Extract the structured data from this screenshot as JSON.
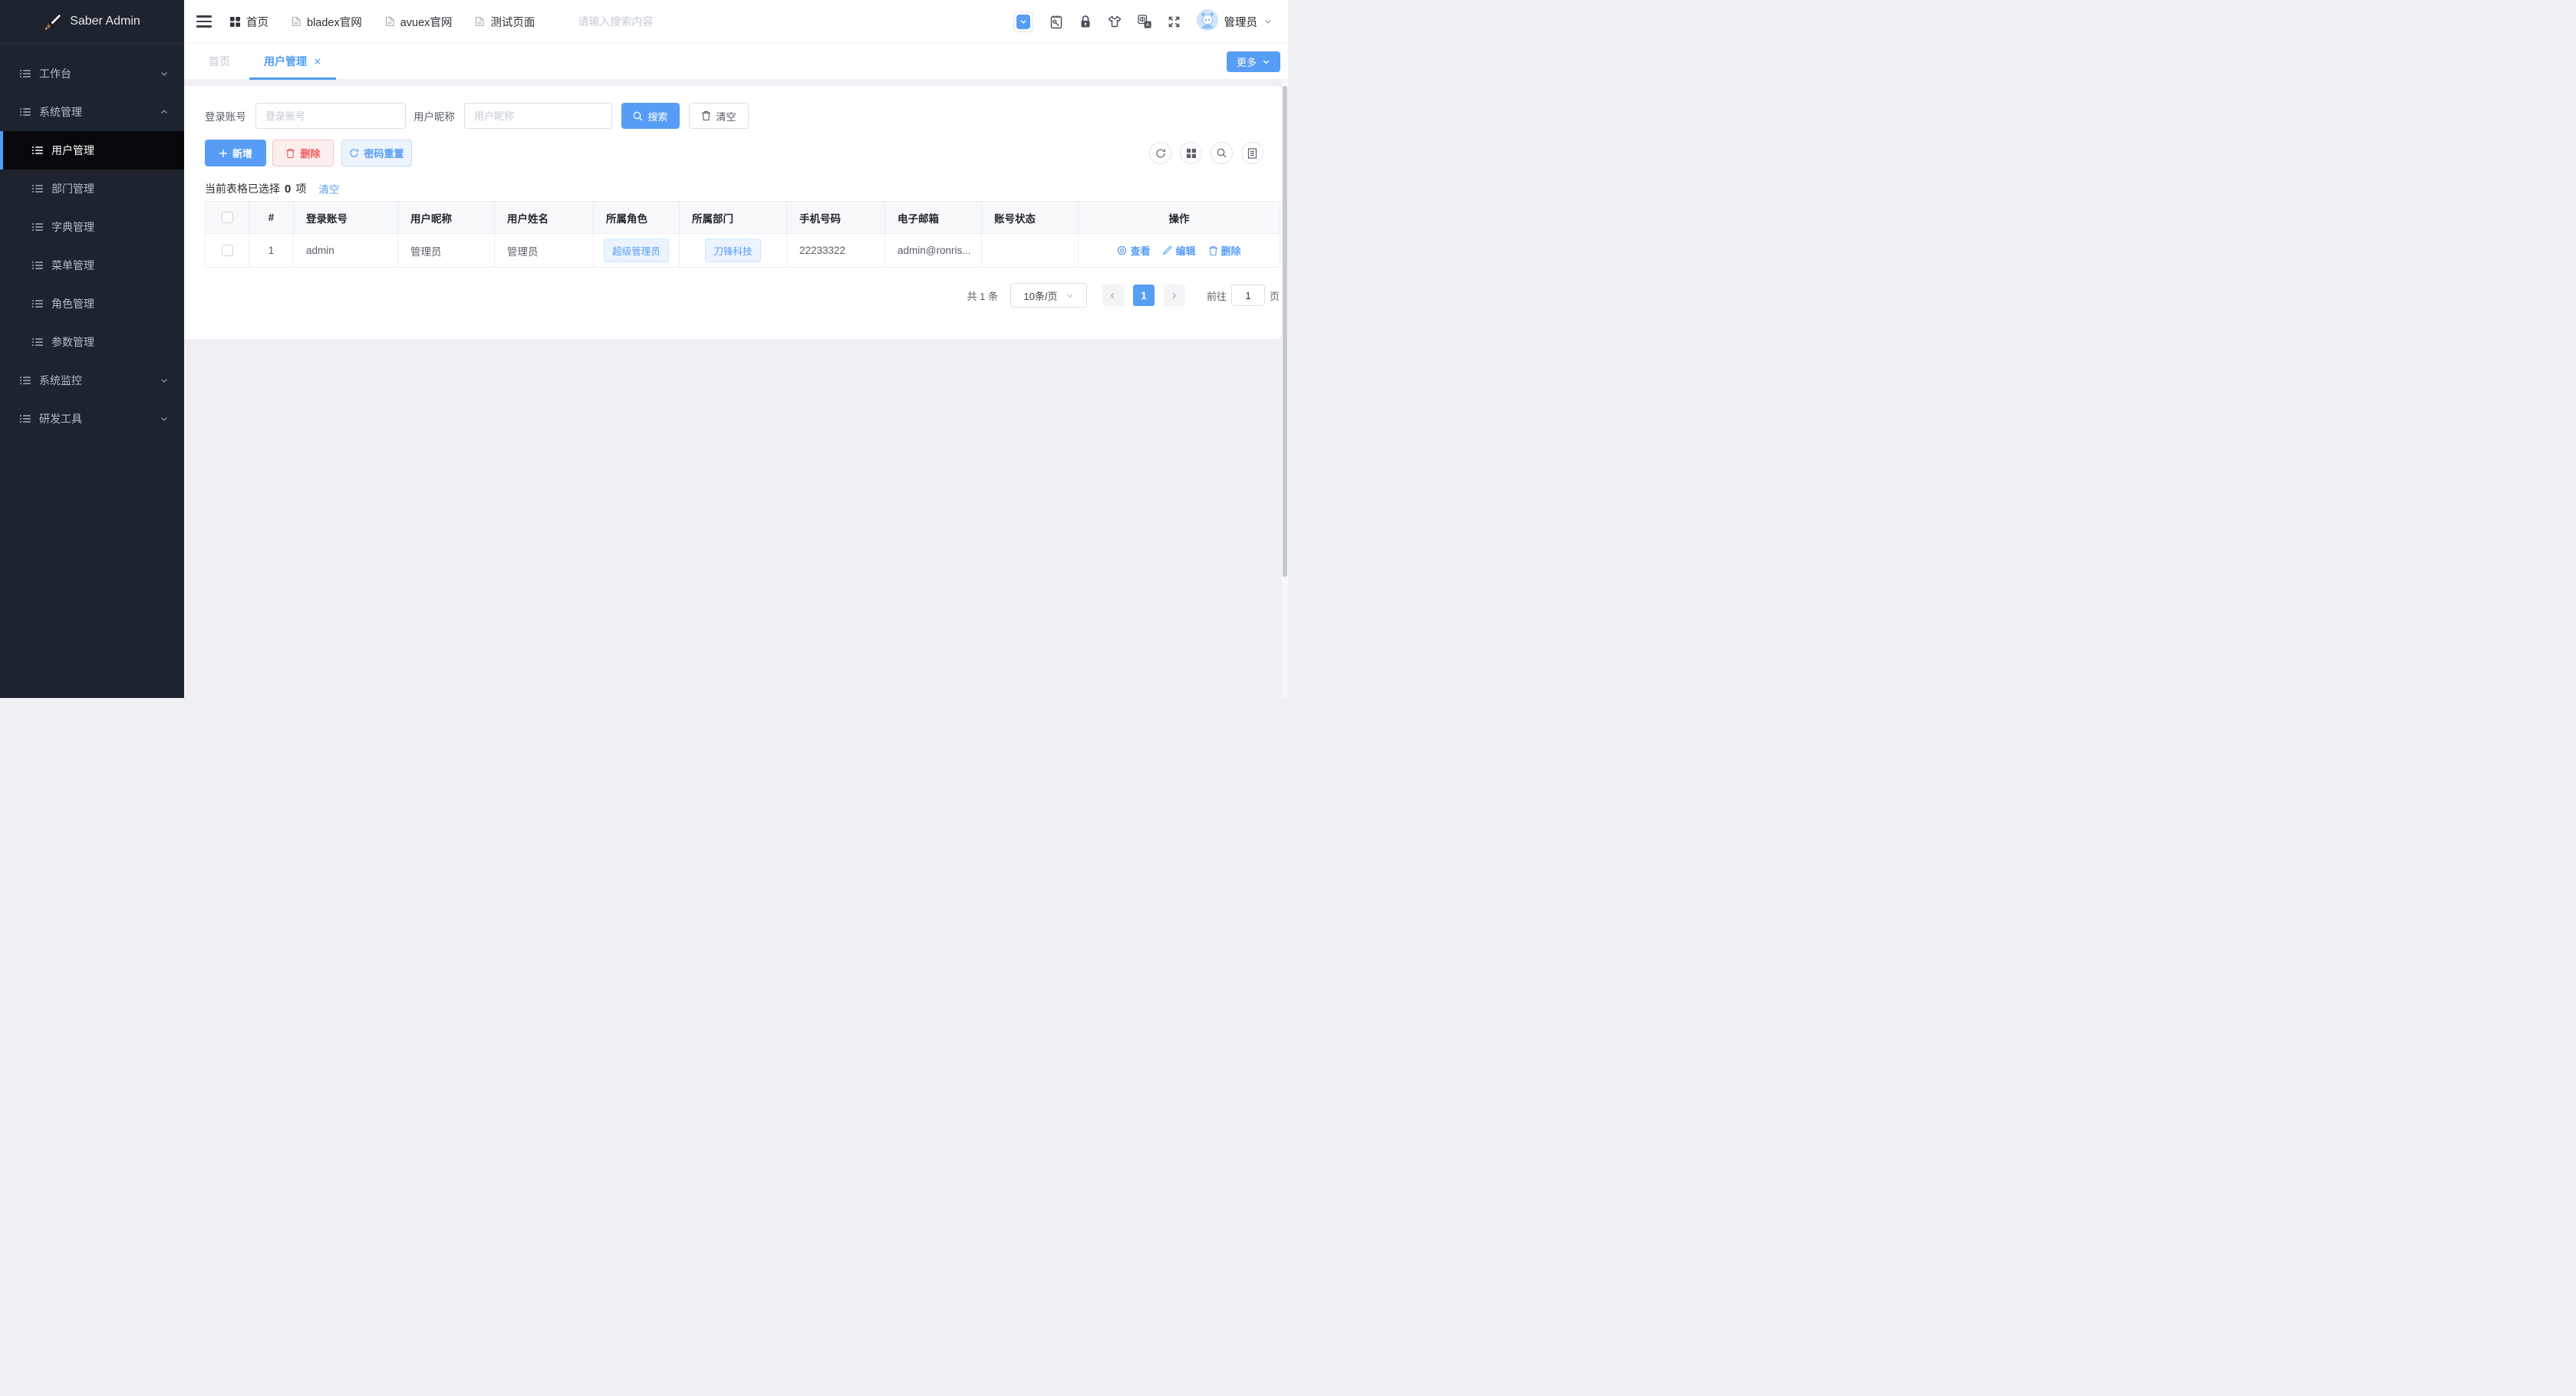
{
  "app": {
    "title": "Saber Admin"
  },
  "colors": {
    "primary": "#579df5",
    "danger": "#f15b5b",
    "sidebar_bg": "#1e242d",
    "sidebar_active_bg": "#07080b",
    "content_bg": "#eef0f4",
    "tag_bg": "#eaf3fe"
  },
  "icons": {
    "logo": "sword-icon",
    "topbar_left": [
      "hamburger-icon",
      "grid-icon",
      "document-icon"
    ],
    "topbar_right": [
      "collapse-toggle-icon",
      "clipboard-wrench-icon",
      "lock-icon",
      "tshirt-icon",
      "translate-icon",
      "fullscreen-icon"
    ],
    "toolbar_circles": [
      "refresh-icon",
      "grid-icon",
      "search-icon",
      "list-icon"
    ],
    "row_actions": [
      "eye-icon",
      "pencil-icon",
      "trash-icon"
    ]
  },
  "sidebar": {
    "items": [
      {
        "label": "工作台"
      },
      {
        "label": "系统管理"
      },
      {
        "label": "系统监控"
      },
      {
        "label": "研发工具"
      }
    ],
    "system_children": [
      {
        "label": "用户管理"
      },
      {
        "label": "部门管理"
      },
      {
        "label": "字典管理"
      },
      {
        "label": "菜单管理"
      },
      {
        "label": "角色管理"
      },
      {
        "label": "参数管理"
      }
    ]
  },
  "topbar": {
    "nav": [
      {
        "label": "首页"
      },
      {
        "label": "bladex官网"
      },
      {
        "label": "avuex官网"
      },
      {
        "label": "测试页面"
      }
    ],
    "search_placeholder": "请输入搜索内容",
    "user_name": "管理员"
  },
  "tabbar": {
    "tabs": [
      {
        "label": "首页"
      },
      {
        "label": "用户管理"
      }
    ],
    "more_label": "更多"
  },
  "filters": {
    "account_label": "登录账号",
    "account_placeholder": "登录账号",
    "nickname_label": "用户昵称",
    "nickname_placeholder": "用户昵称",
    "search_label": "搜索",
    "clear_label": "清空"
  },
  "toolbar": {
    "add_label": "新增",
    "delete_label": "删除",
    "reset_label": "密码重置"
  },
  "selection": {
    "prefix": "当前表格已选择",
    "count": "0",
    "suffix": "项",
    "clear_label": "清空"
  },
  "table": {
    "columns": [
      "#",
      "登录账号",
      "用户昵称",
      "用户姓名",
      "所属角色",
      "所属部门",
      "手机号码",
      "电子邮箱",
      "账号状态",
      "操作"
    ],
    "rows": [
      {
        "index": "1",
        "account": "admin",
        "nickname": "管理员",
        "real_name": "管理员",
        "role_tag": "超级管理员",
        "dept_tag": "刀锋科技",
        "phone": "22233322",
        "email": "admin@ronris...",
        "status": "",
        "view_label": "查看",
        "edit_label": "编辑",
        "delete_label": "删除"
      }
    ]
  },
  "pagination": {
    "total_text": "共 1 条",
    "page_size_text": "10条/页",
    "current_page": "1",
    "goto_prefix": "前往",
    "goto_value": "1",
    "goto_suffix": "页"
  }
}
